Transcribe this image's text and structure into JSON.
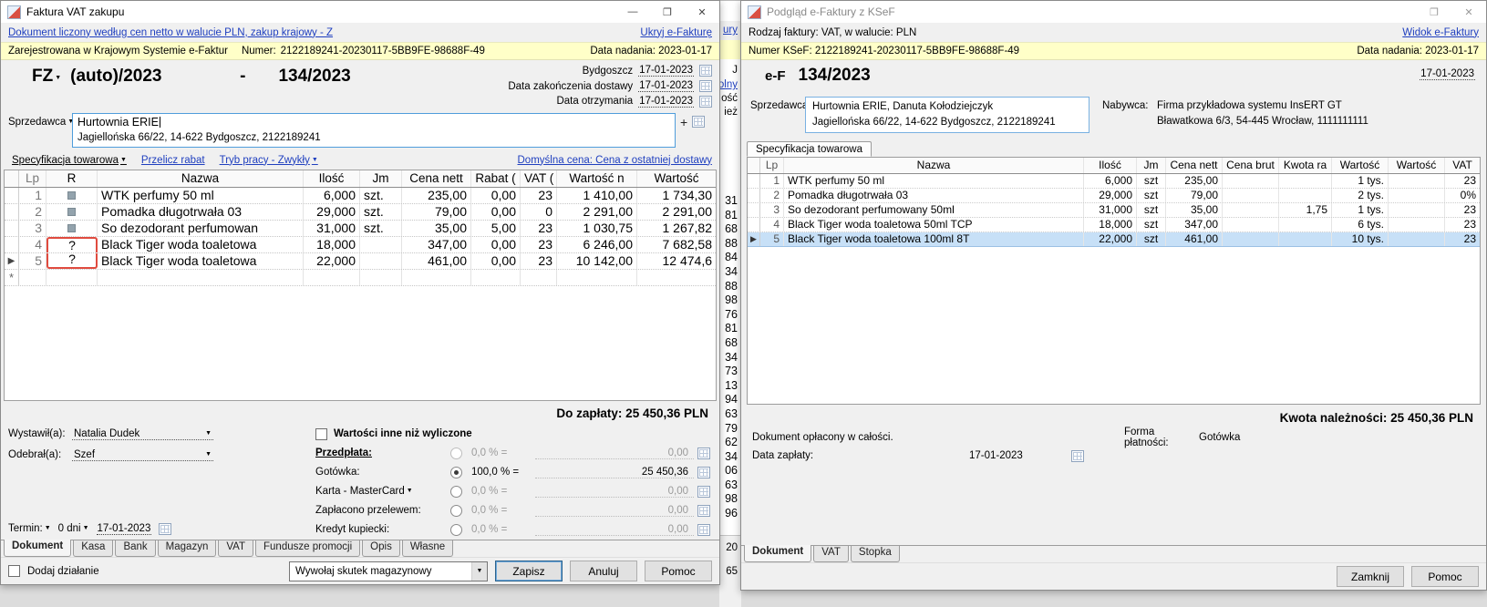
{
  "icons": {
    "minimize": "—",
    "maximize": "❐",
    "close": "✕",
    "dropdown": "▼",
    "row_marker": "▶",
    "new_row": "*",
    "plus": "+"
  },
  "left": {
    "title": "Faktura VAT zakupu",
    "top_link": "Dokument liczony według cen netto w walucie PLN, zakup krajowy - Z",
    "hide_link": "Ukryj e-Fakturę",
    "ksef": {
      "registered": "Zarejestrowana w Krajowym Systemie e-Faktur",
      "number_label": "Numer:",
      "number": "2122189241-20230117-5BB9FE-98688F-49",
      "sent_date": "Data nadania: 2023-01-17"
    },
    "docnum": {
      "type": "FZ",
      "auto": "(auto)/2023",
      "dash": "-",
      "number": "134/2023"
    },
    "dates": {
      "city": "Bydgoszcz",
      "issue_date": "17-01-2023",
      "delivery_label": "Data zakończenia dostawy",
      "delivery_date": "17-01-2023",
      "receive_label": "Data otrzymania",
      "receive_date": "17-01-2023"
    },
    "seller_label": "Sprzedawca",
    "seller_name": "Hurtownia ERIE",
    "seller_address": "Jagiellońska 66/22, 14-622 Bydgoszcz, 2122189241",
    "links": {
      "spec": "Specyfikacja towarowa",
      "recalc": "Przelicz rabat",
      "mode": "Tryb pracy - Zwykły",
      "default_price": "Domyślna cena: Cena z ostatniej dostawy"
    },
    "table": {
      "headers": [
        "Lp",
        "R",
        "Nazwa",
        "Ilość",
        "Jm",
        "Cena nett",
        "Rabat (",
        "VAT (",
        "Wartość n",
        "Wartość"
      ],
      "rows": [
        {
          "lp": "1",
          "r": "",
          "nazwa": "WTK perfumy 50 ml",
          "ilosc": "6,000",
          "jm": "szt.",
          "cena": "235,00",
          "rabat": "0,00",
          "vat": "23",
          "wart_n": "1 410,00",
          "wart": "1 734,30"
        },
        {
          "lp": "2",
          "r": "",
          "nazwa": "Pomadka długotrwała 03",
          "ilosc": "29,000",
          "jm": "szt.",
          "cena": "79,00",
          "rabat": "0,00",
          "vat": "0",
          "wart_n": "2 291,00",
          "wart": "2 291,00"
        },
        {
          "lp": "3",
          "r": "",
          "nazwa": "So dezodorant perfumowan",
          "ilosc": "31,000",
          "jm": "szt.",
          "cena": "35,00",
          "rabat": "5,00",
          "vat": "23",
          "wart_n": "1 030,75",
          "wart": "1 267,82"
        },
        {
          "lp": "4",
          "r": "?",
          "nazwa": "Black Tiger woda toaletowa",
          "ilosc": "18,000",
          "jm": "",
          "cena": "347,00",
          "rabat": "0,00",
          "vat": "23",
          "wart_n": "6 246,00",
          "wart": "7 682,58"
        },
        {
          "lp": "5",
          "r": "?",
          "nazwa": "Black Tiger woda toaletowa",
          "ilosc": "22,000",
          "jm": "",
          "cena": "461,00",
          "rabat": "0,00",
          "vat": "23",
          "wart_n": "10 142,00",
          "wart": "12 474,6"
        }
      ]
    },
    "total": "Do zapłaty: 25 450,36 PLN",
    "issued_label": "Wystawił(a):",
    "issued_value": "Natalia Dudek",
    "received_label": "Odebrał(a):",
    "received_value": "Szef",
    "other_values_checkbox": "Wartości inne niż wyliczone",
    "payments": {
      "prepay_label": "Przedpłata:",
      "prepay_percent": "0,0 % =",
      "prepay_value": "0,00",
      "rows": [
        {
          "label": "Gotówka:",
          "percent": "100,0 % =",
          "value": "25 450,36"
        },
        {
          "label": "Karta - MasterCard",
          "percent": "0,0 % =",
          "value": "0,00"
        },
        {
          "label": "Zapłacono przelewem:",
          "percent": "0,0 % =",
          "value": "0,00"
        },
        {
          "label": "Kredyt kupiecki:",
          "percent": "0,0 % =",
          "value": "0,00"
        }
      ]
    },
    "term_label": "Termin:",
    "term_days": "0 dni",
    "term_date": "17-01-2023",
    "tabs": [
      "Dokument",
      "Kasa",
      "Bank",
      "Magazyn",
      "VAT",
      "Fundusze promocji",
      "Opis",
      "Własne"
    ],
    "add_action": "Dodaj działanie",
    "stock_effect": "Wywołaj skutek magazynowy",
    "buttons": {
      "save": "Zapisz",
      "cancel": "Anuluj",
      "help": "Pomoc"
    }
  },
  "strip": {
    "f1": "ury",
    "f2": "J",
    "f3": "olny",
    "f4": "ość",
    "f5": "ież",
    "numbers": [
      "31",
      "81",
      "68",
      "88",
      "84",
      "34",
      "88",
      "98",
      "76",
      "81",
      "68",
      "34",
      "73",
      "13",
      "94",
      "63",
      "79",
      "62",
      "34",
      "06",
      "63",
      "98",
      "96"
    ],
    "b1": "20",
    "b2": "65"
  },
  "right": {
    "title": "Podgląd e-Faktury z KSeF",
    "type_line": "Rodzaj faktury: VAT, w walucie: PLN",
    "view_link": "Widok e-Faktury",
    "ksef_number": "Numer KSeF: 2122189241-20230117-5BB9FE-98688F-49",
    "sent_date": "Data nadania: 2023-01-17",
    "doc_prefix": "e-F",
    "doc_number": "134/2023",
    "doc_date": "17-01-2023",
    "seller_label": "Sprzedawca:",
    "seller_name": "Hurtownia ERIE, Danuta Kołodziejczyk",
    "seller_address": "Jagiellońska 66/22, 14-622 Bydgoszcz, 2122189241",
    "buyer_label": "Nabywca:",
    "buyer_name": "Firma przykładowa systemu InsERT GT",
    "buyer_address": "Bławatkowa 6/3, 54-445 Wrocław, 1111111111",
    "spec_tab": "Specyfikacja towarowa",
    "table": {
      "headers": [
        "Lp",
        "Nazwa",
        "Ilość",
        "Jm",
        "Cena nett",
        "Cena brut",
        "Kwota ra",
        "Wartość",
        "Wartość",
        "VAT"
      ],
      "rows": [
        {
          "lp": "1",
          "nazwa": "WTK perfumy 50 ml",
          "ilosc": "6,000",
          "jm": "szt",
          "cena": "235,00",
          "cena_b": "",
          "kwota": "",
          "wart1": "1 tys.",
          "wart2": "",
          "vat": "23"
        },
        {
          "lp": "2",
          "nazwa": "Pomadka długotrwała 03",
          "ilosc": "29,000",
          "jm": "szt",
          "cena": "79,00",
          "cena_b": "",
          "kwota": "",
          "wart1": "2 tys.",
          "wart2": "",
          "vat": "0%"
        },
        {
          "lp": "3",
          "nazwa": "So dezodorant perfumowany 50ml",
          "ilosc": "31,000",
          "jm": "szt",
          "cena": "35,00",
          "cena_b": "",
          "kwota": "1,75",
          "wart1": "1 tys.",
          "wart2": "",
          "vat": "23"
        },
        {
          "lp": "4",
          "nazwa": "Black Tiger woda toaletowa 50ml TCP",
          "ilosc": "18,000",
          "jm": "szt",
          "cena": "347,00",
          "cena_b": "",
          "kwota": "",
          "wart1": "6 tys.",
          "wart2": "",
          "vat": "23"
        },
        {
          "lp": "5",
          "nazwa": "Black Tiger woda toaletowa 100ml 8T",
          "ilosc": "22,000",
          "jm": "szt",
          "cena": "461,00",
          "cena_b": "",
          "kwota": "",
          "wart1": "10 tys.",
          "wart2": "",
          "vat": "23"
        }
      ]
    },
    "total": "Kwota należności: 25 450,36 PLN",
    "paid_info": "Dokument opłacony w całości.",
    "payment_form_label": "Forma płatności:",
    "payment_form_value": "Gotówka",
    "pay_date_label": "Data zapłaty:",
    "pay_date_value": "17-01-2023",
    "tabs": [
      "Dokument",
      "VAT",
      "Stopka"
    ],
    "buttons": {
      "close": "Zamknij",
      "help": "Pomoc"
    }
  }
}
